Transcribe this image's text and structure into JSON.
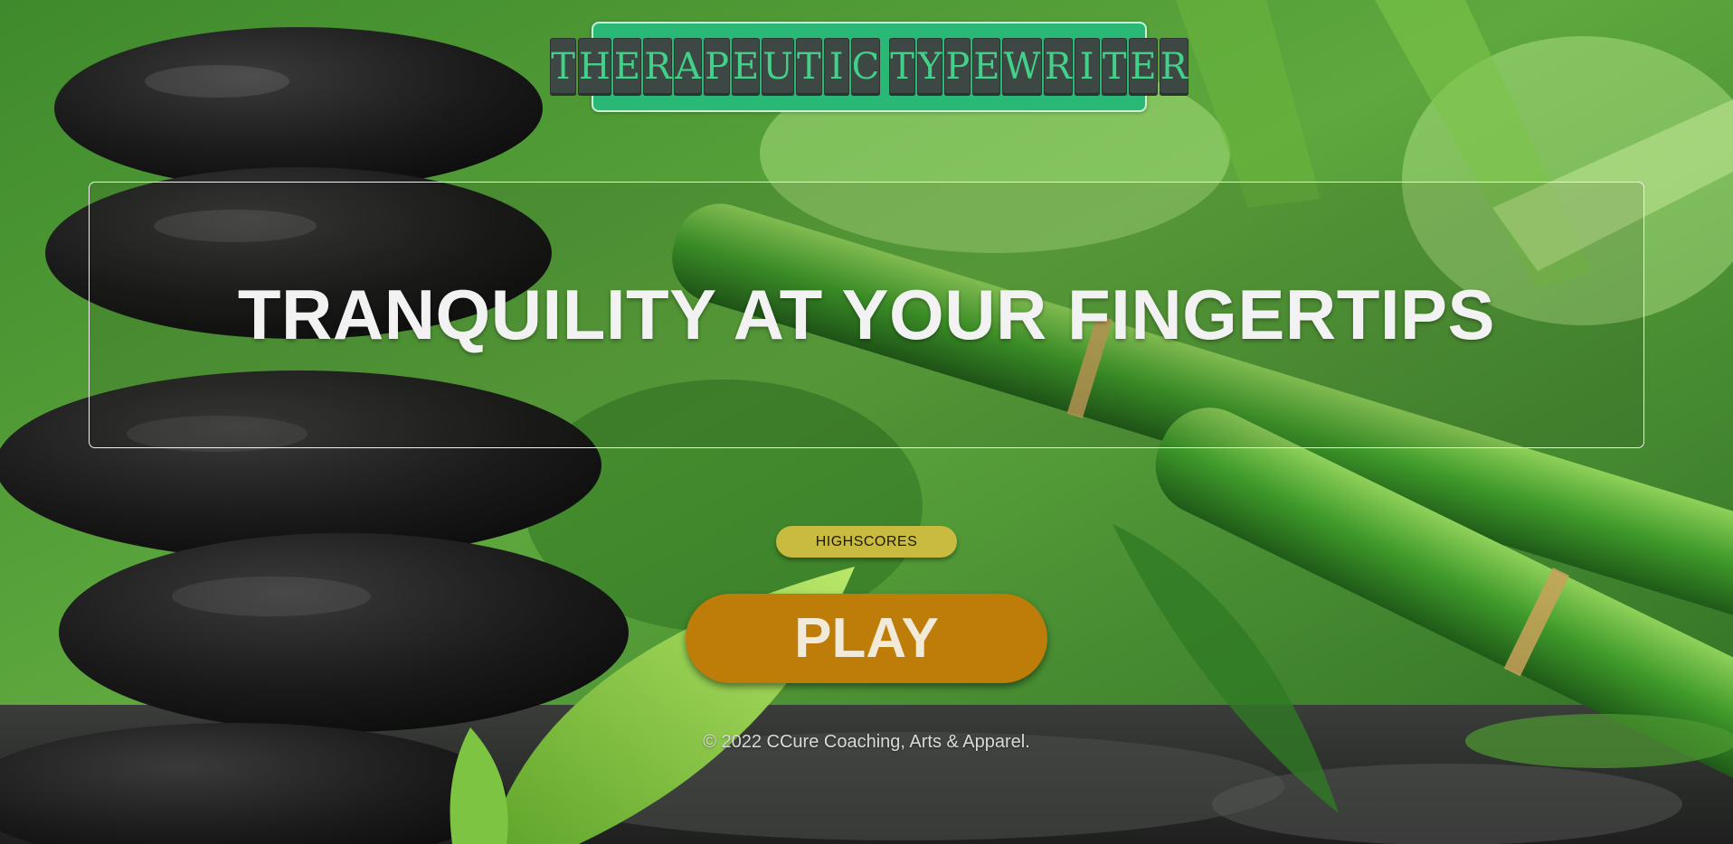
{
  "logo": {
    "words": [
      "THERAPEUTIC",
      "TYPEWRITER"
    ]
  },
  "hero": {
    "title": "TRANQUILITY AT YOUR FINGERTIPS"
  },
  "buttons": {
    "highscores": "HIGHSCORES",
    "play": "PLAY"
  },
  "footer": {
    "copyright": "© 2022 CCure Coaching, Arts & Apparel."
  },
  "colors": {
    "logo_bg": "#2ab877",
    "logo_keys": "#3d4743",
    "logo_letters": "#43d18a",
    "highscores_bg": "#c8bb3f",
    "play_bg": "#be7d08",
    "text_light": "#f2f2f2"
  },
  "background": {
    "scene": "wet black zen stones stacked beside green bamboo and leaves"
  }
}
